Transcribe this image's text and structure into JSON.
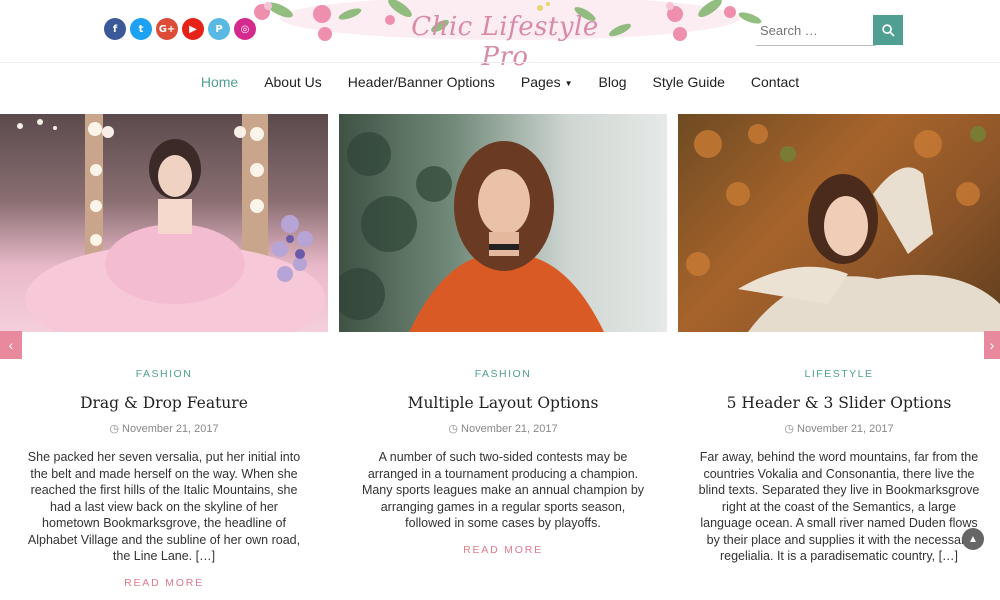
{
  "site": {
    "logo": "Chic Lifestyle Pro",
    "socials": [
      {
        "name": "facebook-icon",
        "glyph": "f",
        "color": "#3b5998"
      },
      {
        "name": "twitter-icon",
        "glyph": "t",
        "color": "#1da1f2"
      },
      {
        "name": "google-plus-icon",
        "glyph": "G+",
        "color": "#dd4b39"
      },
      {
        "name": "youtube-icon",
        "glyph": "▶",
        "color": "#e62117"
      },
      {
        "name": "pinterest-icon",
        "glyph": "P",
        "color": "#5ab9e2"
      },
      {
        "name": "instagram-icon",
        "glyph": "◎",
        "color": "#d42a8e"
      }
    ],
    "search": {
      "placeholder": "Search …"
    }
  },
  "nav": {
    "items": [
      "Home",
      "About Us",
      "Header/Banner Options",
      "Pages",
      "Blog",
      "Style Guide",
      "Contact"
    ]
  },
  "posts": [
    {
      "category": "FASHION",
      "title": "Drag & Drop Feature",
      "date": "November 21, 2017",
      "excerpt": "She packed her seven versalia, put her initial into the belt and made herself on the way. When she reached the first hills of the Italic Mountains, she had a last view back on the skyline of her hometown Bookmarksgrove, the headline of Alphabet Village and the subline of her own road, the Line Lane. […]",
      "more": "READ MORE"
    },
    {
      "category": "FASHION",
      "title": "Multiple Layout Options",
      "date": "November 21, 2017",
      "excerpt": "A number of such two-sided contests may be arranged in a tournament producing a champion. Many sports leagues make an annual champion by arranging games in a regular sports season, followed in some cases by playoffs.",
      "more": "READ MORE"
    },
    {
      "category": "LIFESTYLE",
      "title": "5 Header & 3 Slider Options",
      "date": "November 21, 2017",
      "excerpt": "Far away, behind the word mountains, far from the countries Vokalia and Consonantia, there live the blind texts. Separated they live in Bookmarksgrove right at the coast of the Semantics, a large language ocean. A small river named Duden flows by their place and supplies it with the necessary regelialia. It is a paradisematic country, […]",
      "more": ""
    }
  ],
  "colors": {
    "accent": "#4fa093",
    "pink": "#e07a8c"
  }
}
